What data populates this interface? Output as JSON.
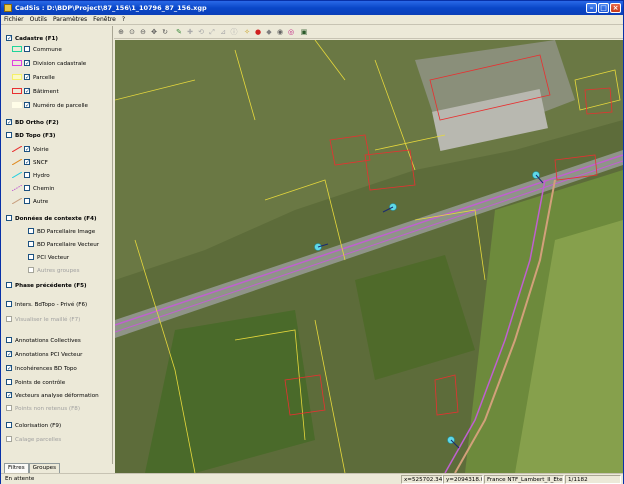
{
  "window": {
    "title": "CadSis : D:\\BDP\\Project\\87_156\\1_10796_87_156.xgp"
  },
  "menu": [
    "Fichier",
    "Outils",
    "Paramètres",
    "Fenêtre",
    "?"
  ],
  "layers": {
    "cadastre": "Cadastre (F1)",
    "commune": "Commune",
    "division": "Division cadastrale",
    "parcelle": "Parcelle",
    "batiment": "Bâtiment",
    "numero": "Numéro de parcelle",
    "bdortho": "BD Ortho (F2)",
    "bdtopo": "BD Topo (F3)",
    "voirie": "Voirie",
    "sncf": "SNCF",
    "hydro": "Hydro",
    "chemin": "Chemin",
    "autre": "Autre",
    "contexte": "Données de contexte (F4)",
    "bdp_image": "BD Parcellaire Image",
    "bdp_vecteur": "BD Parcellaire Vecteur",
    "pci_vecteur": "PCI Vecteur",
    "autres_groupes": "Autres groupes",
    "phase": "Phase précédente (F5)",
    "inters": "Inters. BdTopo - Privé (F6)",
    "visualiser": "Visualiser le maillé (F7)",
    "annot_coll": "Annotations Collectives",
    "annot_pci": "Annotations PCI Vecteur",
    "incoherences": "Incohérences BD Topo",
    "points": "Points de contrôle",
    "vecteurs": "Vecteurs analyse déformation",
    "points_non": "Points non retenus (F8)",
    "colorisation": "Colorisation (F9)",
    "calage": "Calage parcelles"
  },
  "tabs": {
    "filtres": "Filtres",
    "groupes": "Groupes"
  },
  "status": {
    "state": "En attente",
    "x": "x=525702.342",
    "y": "y=2094318.022",
    "projection": "France NTF_Lambert_II_Etendu",
    "scale": "1/1182"
  },
  "colors": {
    "titlebar": "#0a47c8",
    "commune": "#1fd49a",
    "division": "#e040e0",
    "parcelle": "#f5f06a",
    "batiment": "#e83030",
    "voirie": "#e83030",
    "sncf": "#e08a20",
    "hydro": "#2ad0e0",
    "chemin": "#c060d0",
    "autre": "#c8a080"
  },
  "icons": [
    "zoom-in-icon",
    "zoom-window-icon",
    "zoom-out-icon",
    "pan-icon",
    "refresh-icon",
    "select-icon",
    "move-icon",
    "rotate-icon",
    "scale-icon",
    "measure-icon",
    "info-icon",
    "pin-icon",
    "red-marker-icon",
    "blue-marker-icon",
    "circle-icon",
    "target-icon",
    "image-icon"
  ]
}
